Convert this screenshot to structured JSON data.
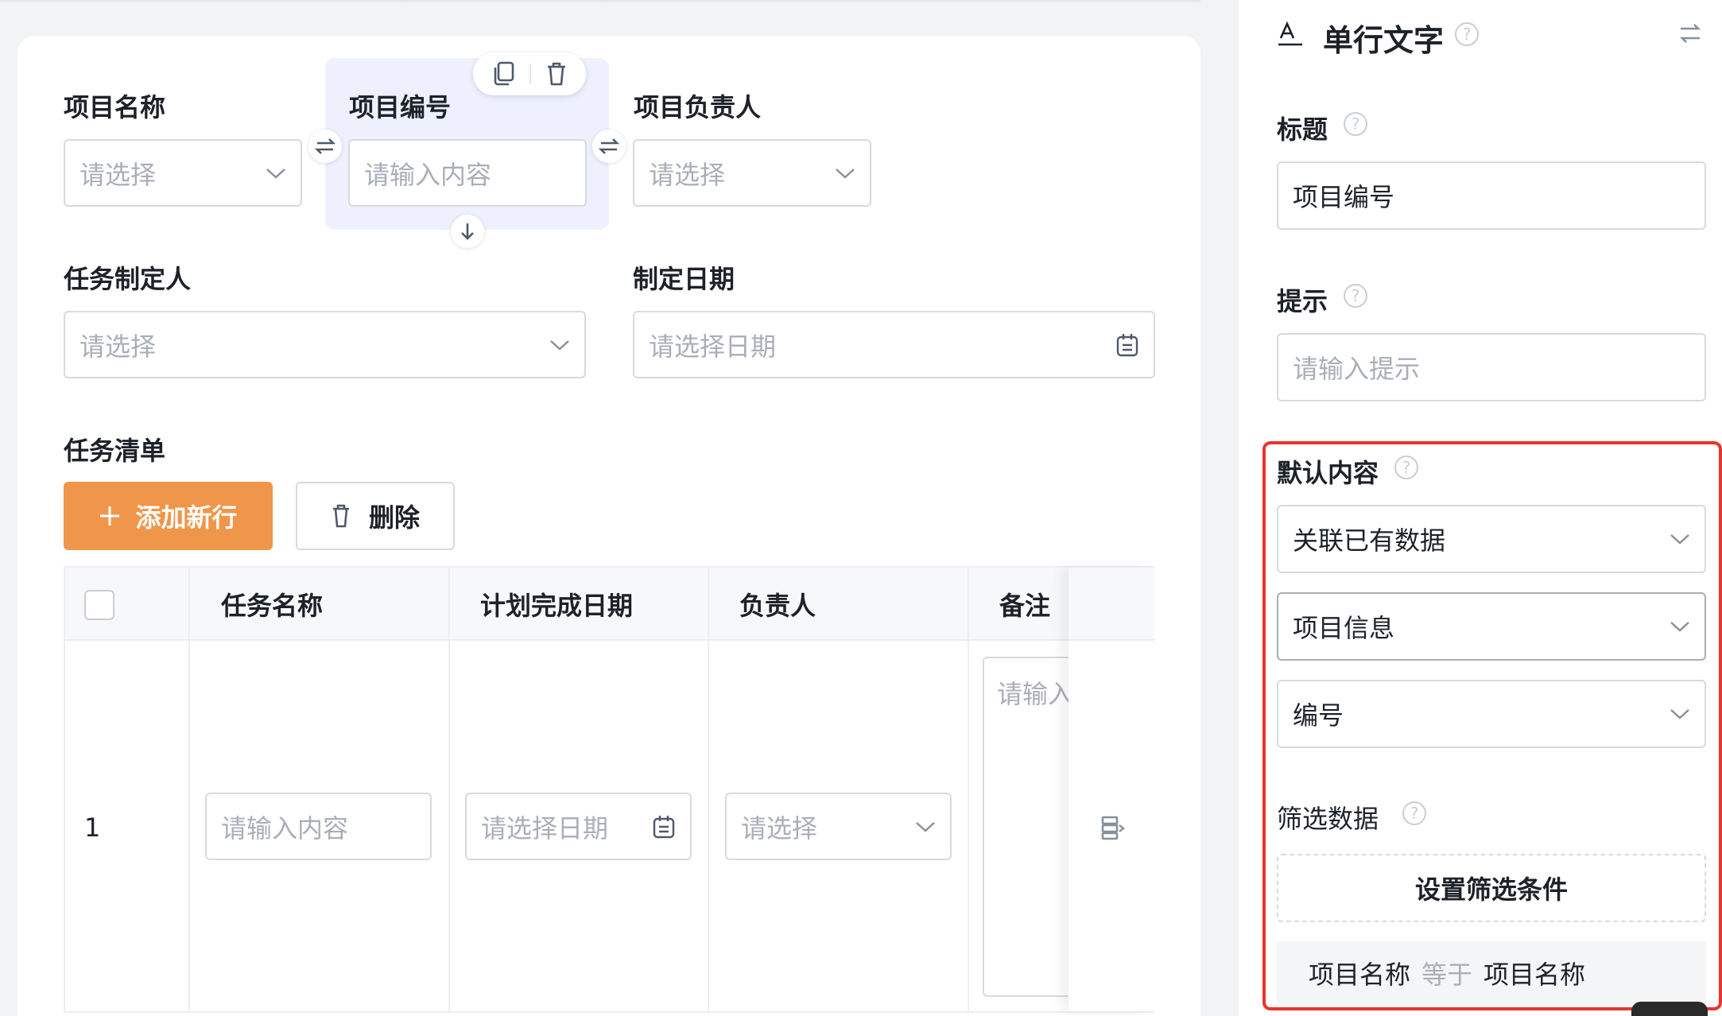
{
  "form": {
    "project_name": {
      "label": "项目名称",
      "placeholder": "请选择"
    },
    "project_number": {
      "label": "项目编号",
      "placeholder": "请输入内容"
    },
    "project_owner": {
      "label": "项目负责人",
      "placeholder": "请选择"
    },
    "task_creator": {
      "label": "任务制定人",
      "placeholder": "请选择"
    },
    "creation_date": {
      "label": "制定日期",
      "placeholder": "请选择日期"
    }
  },
  "task_list": {
    "label": "任务清单",
    "add_button": "添加新行",
    "delete_button": "删除",
    "columns": [
      "任务名称",
      "计划完成日期",
      "负责人",
      "备注"
    ],
    "rows": [
      {
        "index": "1",
        "task_name_placeholder": "请输入内容",
        "date_placeholder": "请选择日期",
        "owner_placeholder": "请选择",
        "remark_placeholder": "请输入"
      }
    ]
  },
  "panel": {
    "component_title": "单行文字",
    "title_label": "标题",
    "title_value": "项目编号",
    "hint_label": "提示",
    "hint_placeholder": "请输入提示",
    "default_label": "默认内容",
    "default_mode": "关联已有数据",
    "source_form": "项目信息",
    "source_field": "编号",
    "filter_label": "筛选数据",
    "filter_button": "设置筛选条件",
    "condition": {
      "field": "项目名称",
      "operator": "等于",
      "value": "项目名称"
    }
  },
  "colors": {
    "accent_orange": "#f0964a",
    "highlight_red": "#e9342c",
    "selected_bg": "#eef1fd"
  }
}
